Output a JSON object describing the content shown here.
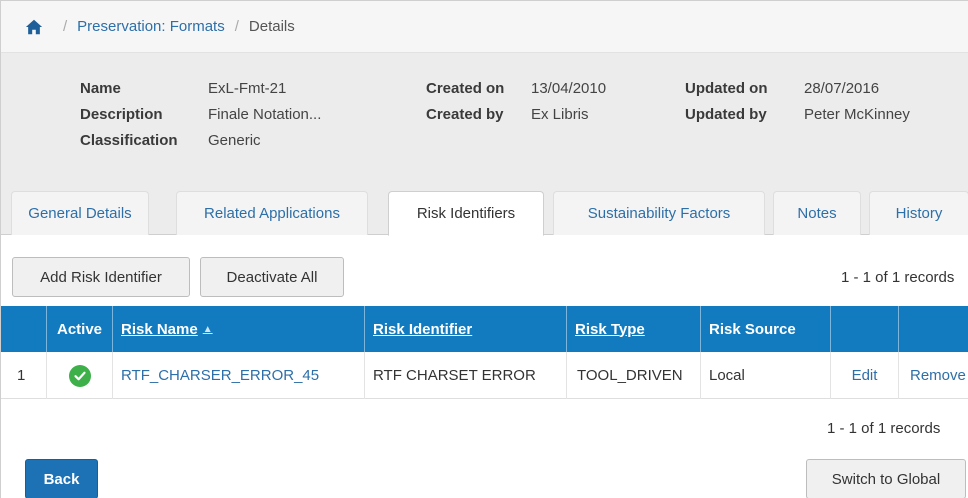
{
  "breadcrumb": {
    "home_icon": "home-icon",
    "link": "Preservation: Formats",
    "current": "Details",
    "separator": "/"
  },
  "details": {
    "name_label": "Name",
    "name_value": "ExL-Fmt-21",
    "description_label": "Description",
    "description_value": "Finale Notation...",
    "classification_label": "Classification",
    "classification_value": "Generic",
    "created_on_label": "Created on",
    "created_on_value": "13/04/2010",
    "created_by_label": "Created by",
    "created_by_value": "Ex Libris",
    "updated_on_label": "Updated on",
    "updated_on_value": "28/07/2016",
    "updated_by_label": "Updated by",
    "updated_by_value": "Peter McKinney"
  },
  "tabs": [
    {
      "label": "General Details",
      "active": false
    },
    {
      "label": "Related Applications",
      "active": false
    },
    {
      "label": "Risk Identifiers",
      "active": true
    },
    {
      "label": "Sustainability Factors",
      "active": false
    },
    {
      "label": "Notes",
      "active": false
    },
    {
      "label": "History",
      "active": false
    }
  ],
  "toolbar": {
    "add_label": "Add Risk Identifier",
    "deactivate_label": "Deactivate All",
    "records_top": "1 - 1 of 1 records",
    "records_bottom": "1 - 1 of 1 records"
  },
  "table": {
    "headers": {
      "active": "Active",
      "risk_name": "Risk Name",
      "risk_identifier": "Risk Identifier",
      "risk_type": "Risk Type",
      "risk_source": "Risk Source"
    },
    "rows": [
      {
        "index": "1",
        "active_icon": "check-circle-icon",
        "risk_name": "RTF_CHARSER_ERROR_45",
        "risk_identifier": "RTF CHARSET ERROR",
        "risk_type": "TOOL_DRIVEN",
        "risk_source": "Local",
        "edit": "Edit",
        "remove": "Remove"
      }
    ]
  },
  "footer": {
    "back_label": "Back",
    "switch_label": "Switch to Global"
  },
  "colors": {
    "header_blue": "#127bc0",
    "link_blue": "#2d6fa8",
    "active_green": "#3db04a",
    "back_blue": "#1c72b4"
  }
}
